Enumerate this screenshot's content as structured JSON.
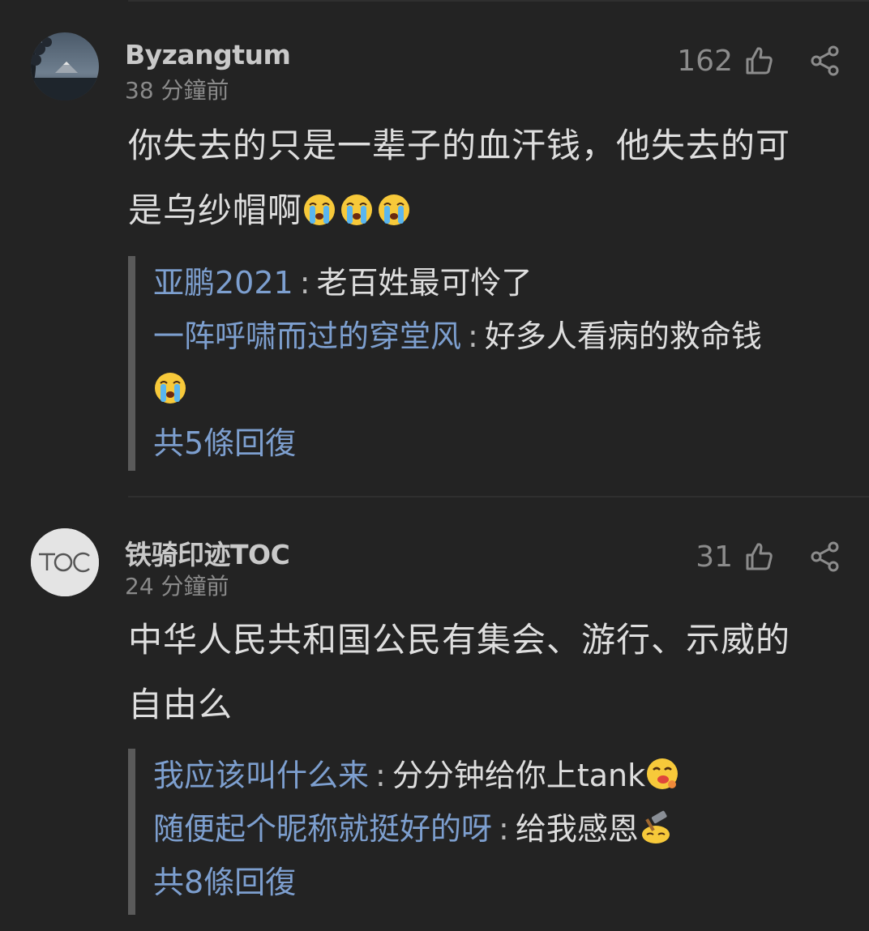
{
  "comments": [
    {
      "username": "Byzangtum",
      "time": "38 分鐘前",
      "likes": "162",
      "text_line1": "你失去的只是一辈子的血汗钱，他失去的可",
      "text_line2": "是乌纱帽啊",
      "text_emojis": [
        "crying-emoji",
        "crying-emoji",
        "crying-emoji"
      ],
      "replies": [
        {
          "name": "亚鹏2021",
          "sep": ":",
          "text": "老百姓最可怜了"
        },
        {
          "name": "一阵呼啸而过的穿堂风",
          "sep": ":",
          "text": "好多人看病的救命钱",
          "emoji": "crying-emoji"
        }
      ],
      "reply_count": "共5條回復"
    },
    {
      "username": "铁骑印迹TOC",
      "avatar_text": "TOC",
      "time": "24 分鐘前",
      "likes": "31",
      "text_line1": "中华人民共和国公民有集会、游行、示威的",
      "text_line2": "自由么",
      "replies": [
        {
          "name": "我应该叫什么来",
          "sep": ":",
          "text": "分分钟给你上tank",
          "emoji": "drooling-emoji"
        },
        {
          "name": "随便起个昵称就挺好的呀",
          "sep": ":",
          "text": "给我感恩",
          "emoji": "hammer-emoji"
        }
      ],
      "reply_count": "共8條回復"
    }
  ],
  "colors": {
    "background": "#232323",
    "link": "#7d9fcf",
    "text": "#dedede",
    "muted": "#8a8a8a"
  }
}
